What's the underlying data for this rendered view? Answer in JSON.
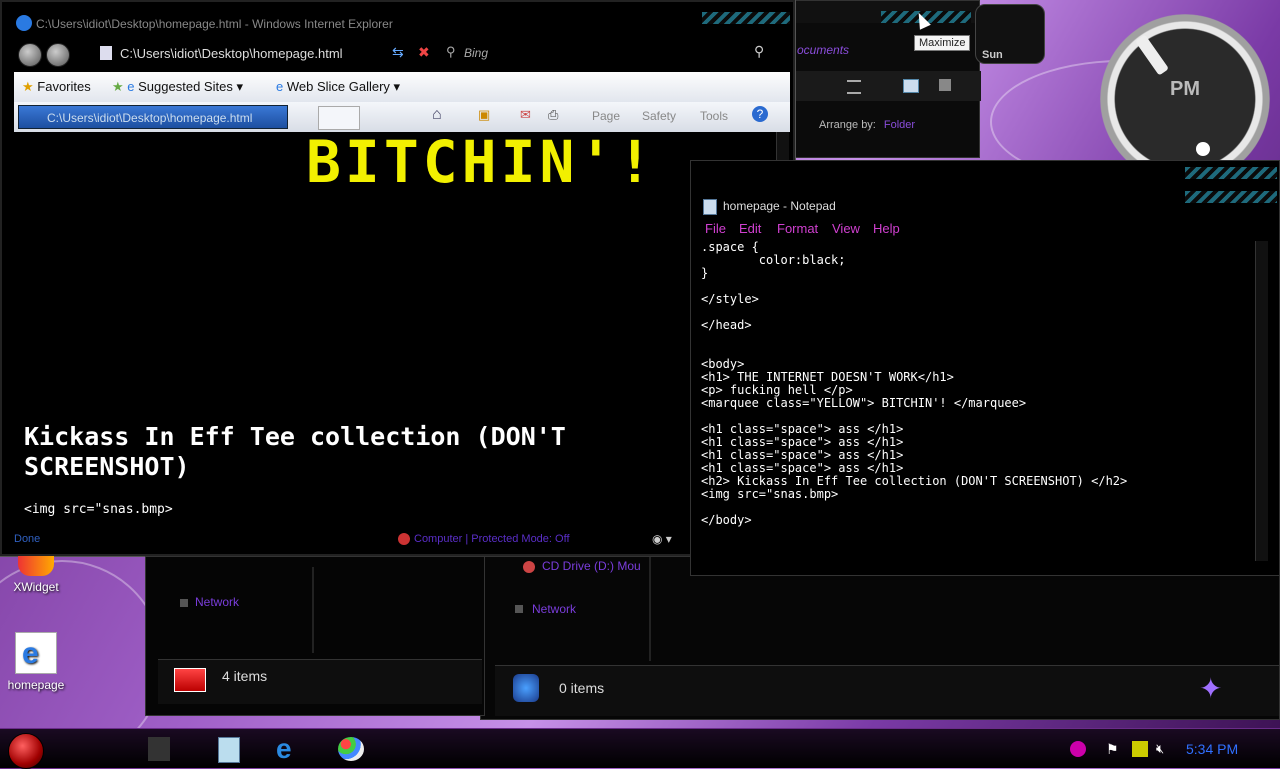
{
  "desktop": {
    "icons": [
      {
        "label": "XWidget"
      },
      {
        "label": "homepage"
      }
    ]
  },
  "clock_gadget": {
    "meridiem": "PM"
  },
  "day_widget": {
    "day": "Sun"
  },
  "tooltip": {
    "text": "Maximize"
  },
  "explorer_top": {
    "link_partial": "ocuments",
    "arrange_label": "Arrange by:",
    "arrange_value": "Folder"
  },
  "ie": {
    "title": "C:\\Users\\idiot\\Desktop\\homepage.html - Windows Internet Explorer",
    "address": "C:\\Users\\idiot\\Desktop\\homepage.html",
    "search_placeholder": "Bing",
    "favorites": {
      "favorites_label": "Favorites",
      "suggested_sites": "Suggested Sites",
      "web_slice_gallery": "Web Slice Gallery"
    },
    "tab_title": "C:\\Users\\idiot\\Desktop\\homepage.html",
    "command_bar": {
      "page": "Page",
      "safety": "Safety",
      "tools": "Tools"
    },
    "content": {
      "marquee": "BITCHIN'!",
      "heading2": "Kickass In Eff Tee collection (DON'T SCREENSHOT)",
      "img_text": "<img src=\"snas.bmp>"
    },
    "status": {
      "left": "Done",
      "zone": "Computer | Protected Mode: Off"
    }
  },
  "explorer_left": {
    "network": "Network",
    "items": "4 items"
  },
  "explorer_right": {
    "cd_drive": "CD Drive (D:) Mou",
    "network": "Network",
    "items": "0 items"
  },
  "notepad": {
    "title": "homepage - Notepad",
    "menu": [
      "File",
      "Edit",
      "Format",
      "View",
      "Help"
    ],
    "text": ".space {\n        color:black;\n}\n\n</style>\n\n</head>\n\n\n<body>\n<h1> THE INTERNET DOESN'T WORK</h1>\n<p> fucking hell </p>\n<marquee class=\"YELLOW\"> BITCHIN'! </marquee>\n\n<h1 class=\"space\"> ass </h1>\n<h1 class=\"space\"> ass </h1>\n<h1 class=\"space\"> ass </h1>\n<h1 class=\"space\"> ass </h1>\n<h2> Kickass In Eff Tee collection (DON'T SCREENSHOT) </h2>\n<img src=\"snas.bmp>\n\n</body>"
  },
  "taskbar": {
    "time": "5:34 PM"
  },
  "colors": {
    "accent_purple": "#7a3ddb",
    "marquee_yellow": "#f2f000",
    "notepad_menu": "#d040d0",
    "clock_blue": "#3070ff"
  }
}
